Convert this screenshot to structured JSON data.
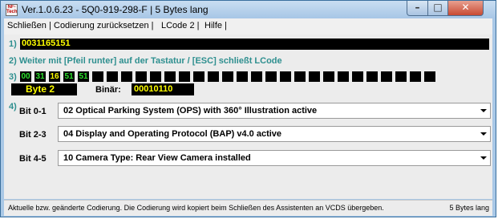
{
  "window": {
    "title": "Ver.1.0.6.23 -   5Q0-919-298-F | 5 Bytes lang"
  },
  "app_icon": {
    "text": "NF-Tech"
  },
  "window_controls": {
    "minimize": "–",
    "maximize": "□",
    "close": "✕"
  },
  "menu": {
    "items": [
      "Schließen |",
      "Codierung zurücksetzen |",
      "LCode 2 |",
      "Hilfe |"
    ]
  },
  "row1": {
    "num": "1)",
    "value": "0031165151"
  },
  "row2": {
    "text": "2) Weiter mit [Pfeil runter] auf der Tastatur / [ESC] schließt LCode"
  },
  "row3": {
    "num": "3)",
    "bytes": [
      "00",
      "31",
      "16",
      "51",
      "51"
    ],
    "selected_index": 2,
    "empty_cells": 24
  },
  "byte": {
    "label": "Byte 2",
    "binar_label": "Binär:",
    "binar_value": "00010110"
  },
  "row4": {
    "num": "4)"
  },
  "bits": [
    {
      "label": "Bit 0-1",
      "value": "02 Optical Parking System (OPS) with 360° Illustration active"
    },
    {
      "label": "Bit 2-3",
      "value": "04 Display and Operating Protocol (BAP) v4.0 active"
    },
    {
      "label": "Bit 4-5",
      "value": "10 Camera Type: Rear View Camera installed"
    }
  ],
  "status": {
    "left": "Aktuelle bzw. geänderte Codierung. Die Codierung wird kopiert beim Schließen des Assistenten an VCDS übergeben.",
    "right": "5 Bytes lang"
  }
}
